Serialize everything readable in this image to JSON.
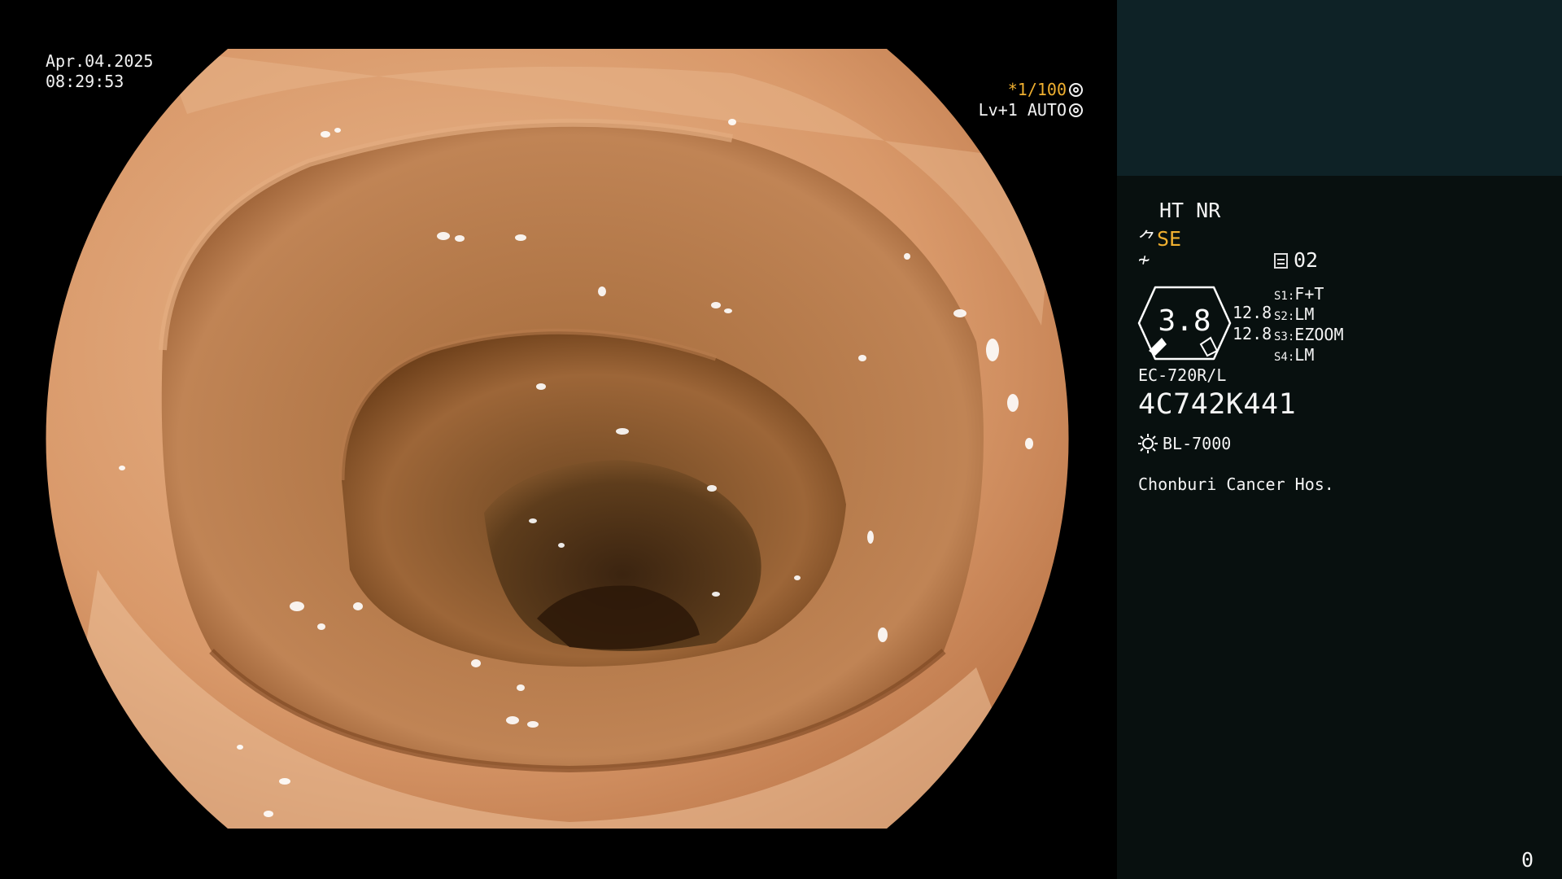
{
  "osd": {
    "date": "Apr.04.2025",
    "time": "08:29:53",
    "shutter": "*1/100",
    "level": "Lv+1 AUTO"
  },
  "panel": {
    "ht_nr": "HT NR",
    "se": "SE",
    "memory": "02",
    "gauge_value": "3.8",
    "value_a": "12.8",
    "value_b": "12.8",
    "s1": {
      "key": "S1:",
      "val": "F+T"
    },
    "s2": {
      "key": "S2:",
      "val": "LM"
    },
    "s3": {
      "key": "S3:",
      "val": "EZOOM"
    },
    "s4": {
      "key": "S4:",
      "val": "LM"
    },
    "scope_model": "EC-720R/L",
    "serial": "4C742K441",
    "light_source": "BL-7000",
    "hospital": "Chonburi Cancer Hos.",
    "counter": "0"
  },
  "colors": {
    "panel_bg": "#08100f",
    "panel_top": "#0e2226",
    "accent": "#f0b030",
    "mucosa": "#c8875a",
    "lumen": "#3a2410"
  }
}
